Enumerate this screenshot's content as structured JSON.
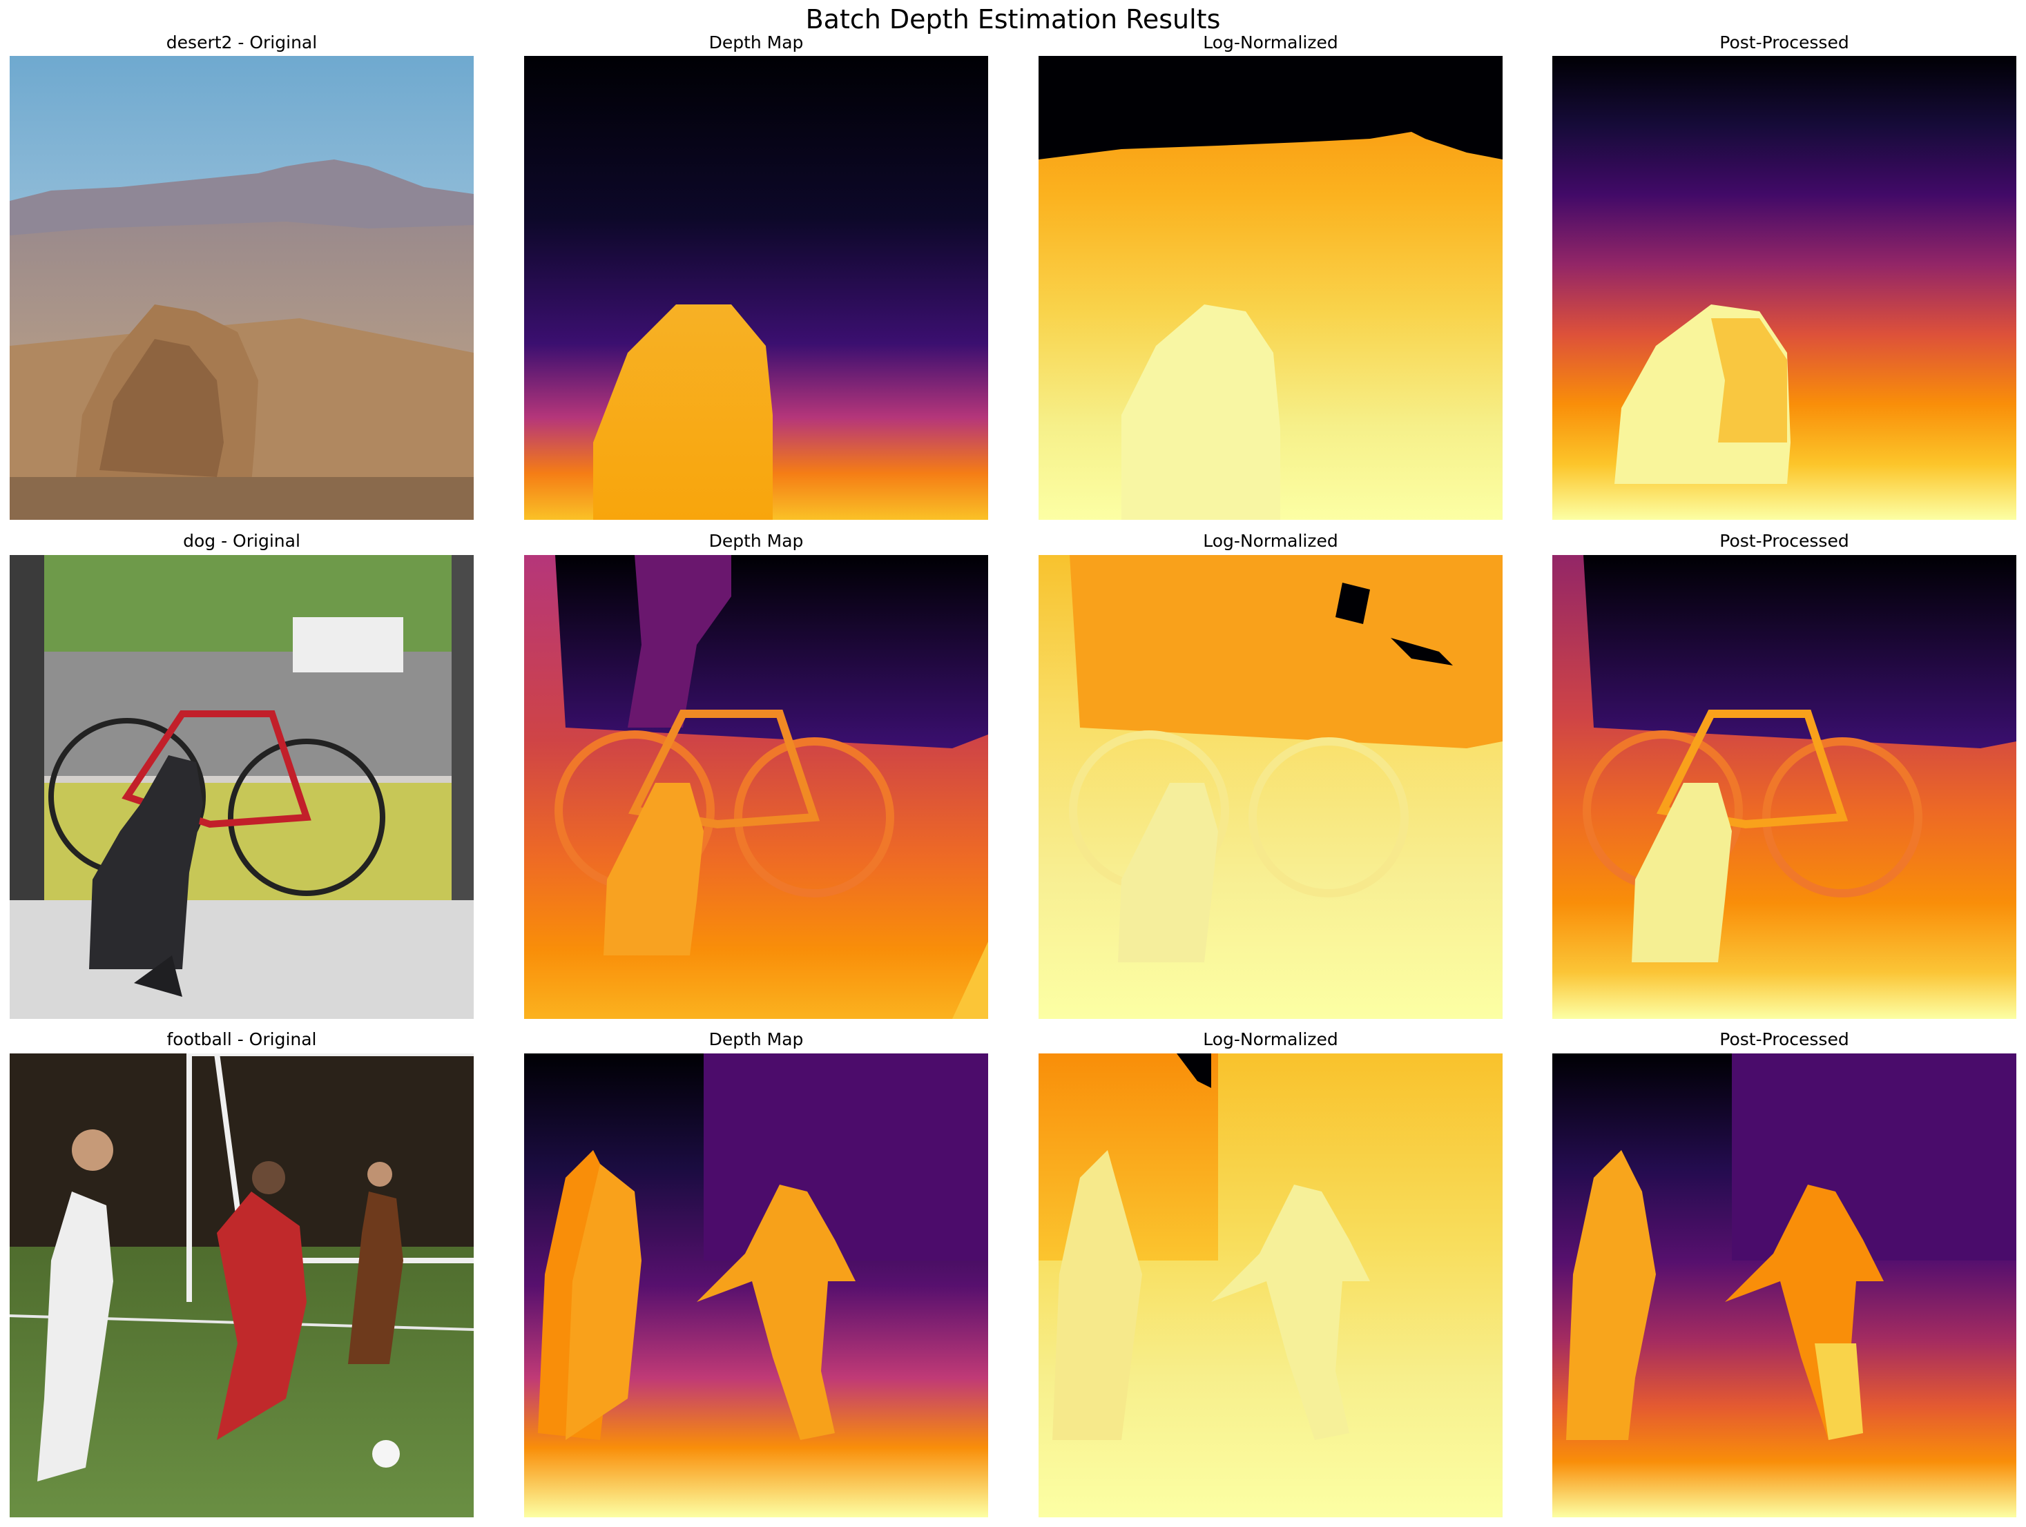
{
  "figure": {
    "title": "Batch Depth Estimation Results"
  },
  "rows": [
    {
      "image": "desert2",
      "titles": [
        "desert2 - Original",
        "Depth Map",
        "Log-Normalized",
        "Post-Processed"
      ]
    },
    {
      "image": "dog",
      "titles": [
        "dog - Original",
        "Depth Map",
        "Log-Normalized",
        "Post-Processed"
      ]
    },
    {
      "image": "football",
      "titles": [
        "football - Original",
        "Depth Map",
        "Log-Normalized",
        "Post-Processed"
      ]
    }
  ],
  "colormap": "inferno",
  "colors": {
    "inferno_dark": "#000004",
    "inferno_purple": "#3b0f70",
    "inferno_magenta": "#8c2981",
    "inferno_red": "#dd4968",
    "inferno_orange": "#f98e09",
    "inferno_yellow": "#fcffa4"
  }
}
